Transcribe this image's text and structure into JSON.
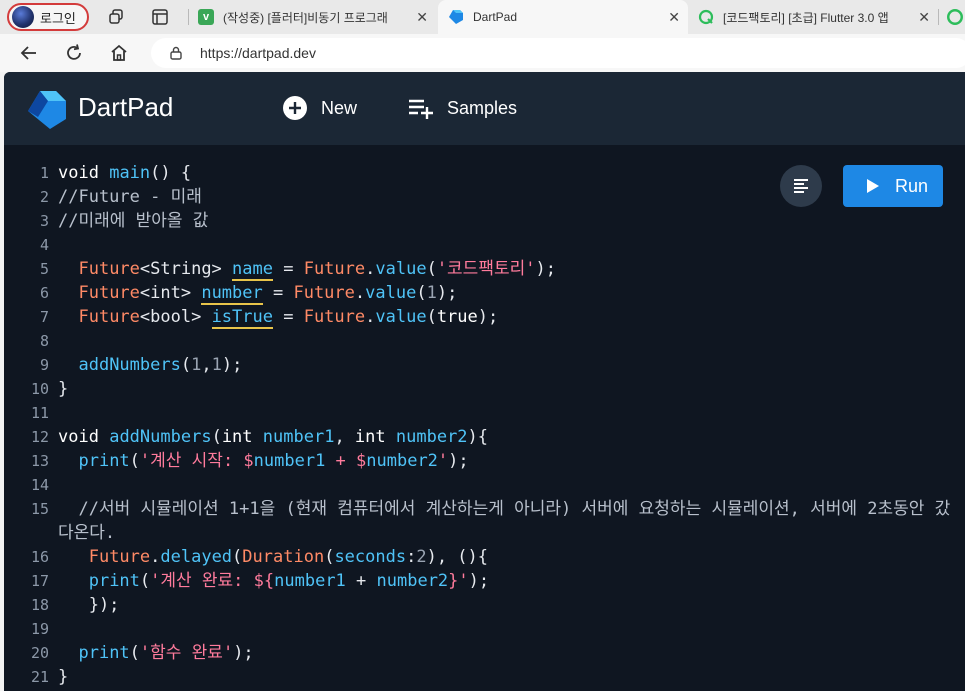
{
  "browser": {
    "profile_label": "로그인",
    "tabs": [
      {
        "title": "(작성중) [플러터]비동기 프로그래",
        "favicon": "v-icon",
        "favicon_color": "#3aa757"
      },
      {
        "title": "DartPad",
        "favicon": "dart-icon",
        "favicon_color": "#1e88e5"
      },
      {
        "title": "[코드팩토리] [초급] Flutter 3.0 앱",
        "favicon": "q-icon",
        "favicon_color": "#2dbd5b"
      }
    ],
    "close_glyph": "✕",
    "url": "https://dartpad.dev"
  },
  "dartpad": {
    "brand": "DartPad",
    "new_label": "New",
    "samples_label": "Samples",
    "run_label": "Run",
    "colors": {
      "header": "#1b2735",
      "editor": "#0f1621",
      "run": "#1e88e5"
    }
  },
  "code_lines": [
    {
      "n": "1"
    },
    {
      "n": "2"
    },
    {
      "n": "3"
    },
    {
      "n": "4"
    },
    {
      "n": "5"
    },
    {
      "n": "6"
    },
    {
      "n": "7"
    },
    {
      "n": "8"
    },
    {
      "n": "9"
    },
    {
      "n": "10"
    },
    {
      "n": "11"
    },
    {
      "n": "12"
    },
    {
      "n": "13"
    },
    {
      "n": "14"
    },
    {
      "n": "15"
    },
    {
      "n": "16"
    },
    {
      "n": "17"
    },
    {
      "n": "18"
    },
    {
      "n": "19"
    },
    {
      "n": "20"
    },
    {
      "n": "21"
    }
  ],
  "code": {
    "l1": [
      "void",
      " ",
      "main",
      "() {"
    ],
    "l2": [
      "//Future - 미래"
    ],
    "l3": [
      "//미래에 받아올 값"
    ],
    "l5": [
      "  ",
      "Future",
      "<String> ",
      "name",
      " = ",
      "Future",
      ".",
      "value",
      "(",
      "'코드팩토리'",
      ");"
    ],
    "l6": [
      "  ",
      "Future",
      "<int> ",
      "number",
      " = ",
      "Future",
      ".",
      "value",
      "(",
      "1",
      ");"
    ],
    "l7": [
      "  ",
      "Future",
      "<bool> ",
      "isTrue",
      " = ",
      "Future",
      ".",
      "value",
      "(",
      "true",
      ");"
    ],
    "l9": [
      "  ",
      "addNumbers",
      "(",
      "1",
      ",",
      "1",
      ");"
    ],
    "l10": [
      "}"
    ],
    "l12": [
      "void",
      " ",
      "addNumbers",
      "(",
      "int",
      " ",
      "number1",
      ", ",
      "int",
      " ",
      "number2",
      "){"
    ],
    "l13": [
      "  ",
      "print",
      "(",
      "'계산 시작: $",
      "number1",
      " + $",
      "number2",
      "'",
      ");"
    ],
    "l15": [
      "  //서버 시뮬레이션 1+1을 (현재 컴퓨터에서 계산하는게 아니라) 서버에 요청하는 시뮬레이션, 서버에 2초동안 갔다온다."
    ],
    "l16": [
      "   ",
      "Future",
      ".",
      "delayed",
      "(",
      "Duration",
      "(",
      "seconds",
      ":",
      "2",
      "), (){"
    ],
    "l17": [
      "   ",
      "print",
      "(",
      "'계산 완료: ${",
      "number1",
      " + ",
      "number2",
      "}'",
      ");"
    ],
    "l18": [
      "   });"
    ],
    "l20": [
      "  ",
      "print",
      "(",
      "'함수 완료'",
      ");"
    ],
    "l21": [
      "}"
    ]
  }
}
